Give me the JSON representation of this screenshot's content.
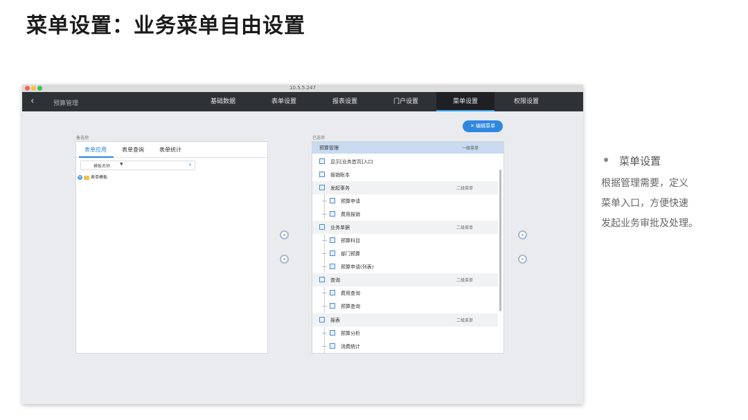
{
  "slide": {
    "title": "菜单设置：业务菜单自由设置"
  },
  "window": {
    "title": "10.5.5.247"
  },
  "navbar": {
    "back_icon": "chevron-left-icon",
    "app_name": "预算管理",
    "items": [
      "基础数据",
      "表单设置",
      "报表设置",
      "门户设置",
      "菜单设置",
      "权限设置"
    ],
    "active": "菜单设置"
  },
  "left_panel": {
    "label": "备选项",
    "tabs": [
      "表单应用",
      "表单查询",
      "表单统计"
    ],
    "active_tab": "表单应用",
    "filter": {
      "label": "模板名称",
      "search_icon": "search-icon"
    },
    "tree_root": "表单模板"
  },
  "edit_button": {
    "label": "✕ 编辑菜单"
  },
  "right_panel": {
    "label": "已选项",
    "header": {
      "title": "预算管理",
      "level": "一级菜单"
    },
    "rows": [
      {
        "text": "显示[业务首页]入口",
        "level": ""
      },
      {
        "text": "报销账本",
        "level": ""
      },
      {
        "text": "发起事务",
        "level": "二级菜单"
      },
      {
        "text": "预算申请",
        "level": ""
      },
      {
        "text": "费用报销",
        "level": ""
      },
      {
        "text": "业务单据",
        "level": "二级菜单"
      },
      {
        "text": "预算科目",
        "level": ""
      },
      {
        "text": "部门预算",
        "level": ""
      },
      {
        "text": "预算申请(列表)",
        "level": ""
      },
      {
        "text": "查询",
        "level": "二级菜单"
      },
      {
        "text": "费用查询",
        "level": ""
      },
      {
        "text": "预算查询",
        "level": ""
      },
      {
        "text": "报表",
        "level": "二级菜单"
      },
      {
        "text": "预算分析",
        "level": ""
      },
      {
        "text": "消费统计",
        "level": ""
      }
    ]
  },
  "side_note": {
    "heading": "菜单设置",
    "lines": [
      "根据管理需要，定义",
      "菜单入口，方便快速",
      "发起业务审批及处理。"
    ]
  }
}
